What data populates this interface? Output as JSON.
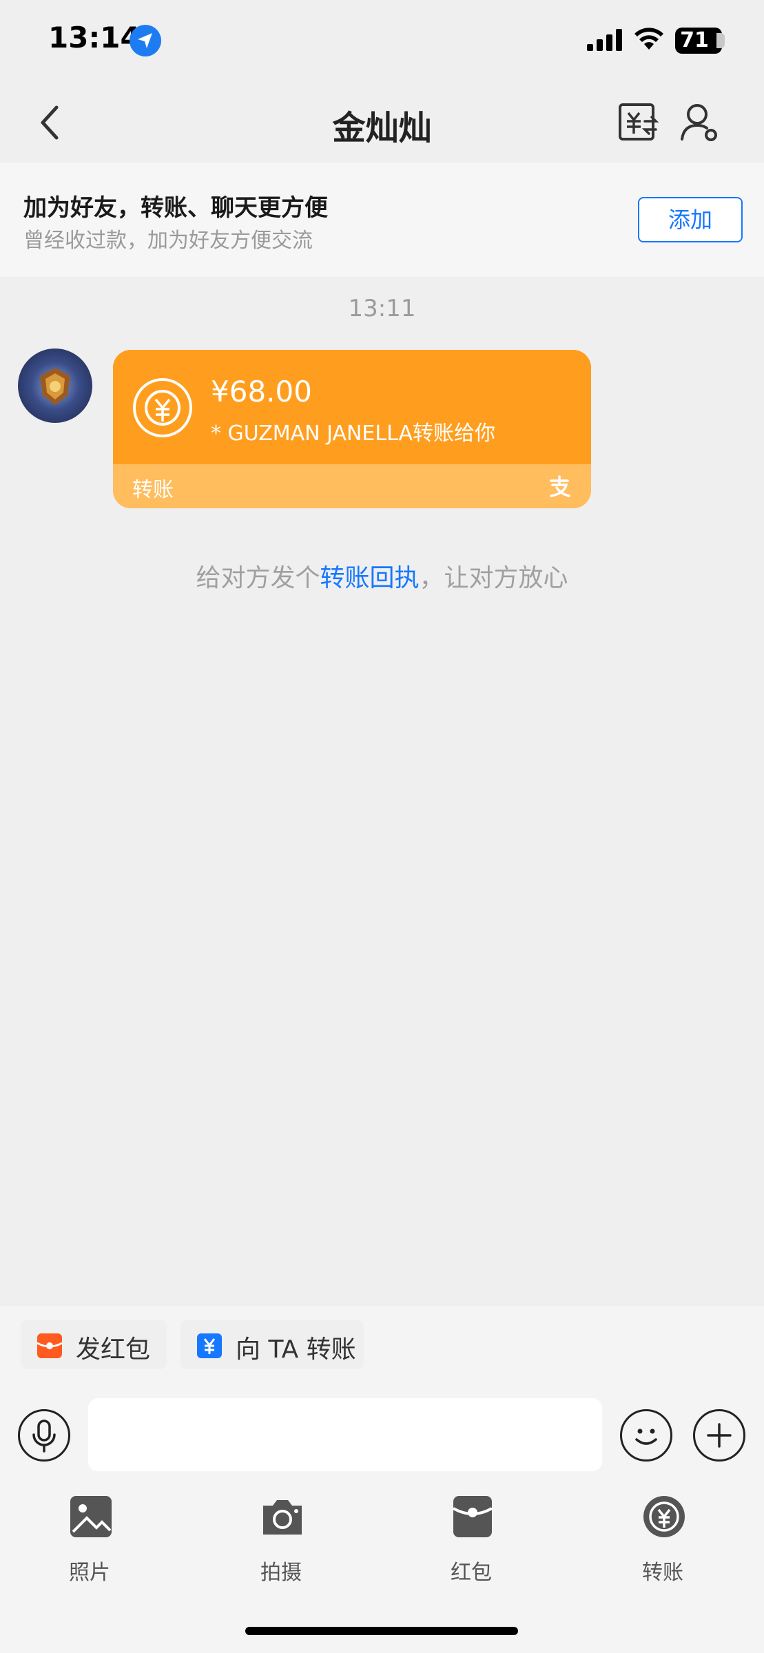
{
  "status_bar": {
    "time": "13:14",
    "battery": "71",
    "icons": [
      "location-arrow-icon",
      "signal-icon",
      "wifi-icon",
      "battery-icon"
    ]
  },
  "header": {
    "title": "金灿灿",
    "icons": [
      "back-icon",
      "transfer-record-icon",
      "profile-settings-icon"
    ]
  },
  "friend_banner": {
    "title": "加为好友，转账、聊天更方便",
    "subtitle": "曾经收过款，加为好友方便交流",
    "add_label": "添加"
  },
  "chat": {
    "time": "13:11",
    "transfer_card": {
      "amount": "¥68.00",
      "sender": "* GUZMAN JANELLA转账给你",
      "label": "转账",
      "color": "#ff9e1e"
    },
    "receipt_hint": {
      "before": "给对方发个",
      "link": "转账回执",
      "after": "，让对方放心"
    }
  },
  "quick_actions": [
    {
      "label": "发红包",
      "icon": "red-packet-icon",
      "color": "#ff5a1f"
    },
    {
      "label": "向 TA 转账",
      "icon": "transfer-icon",
      "color": "#1677ff"
    }
  ],
  "input_bar": {
    "value": "",
    "icons": [
      "microphone-icon",
      "emoji-icon",
      "plus-icon"
    ]
  },
  "tools": [
    {
      "label": "照片",
      "icon": "photo-icon"
    },
    {
      "label": "拍摄",
      "icon": "camera-icon"
    },
    {
      "label": "红包",
      "icon": "red-packet-icon"
    },
    {
      "label": "转账",
      "icon": "transfer-icon"
    }
  ],
  "accent_color": "#1677ff"
}
